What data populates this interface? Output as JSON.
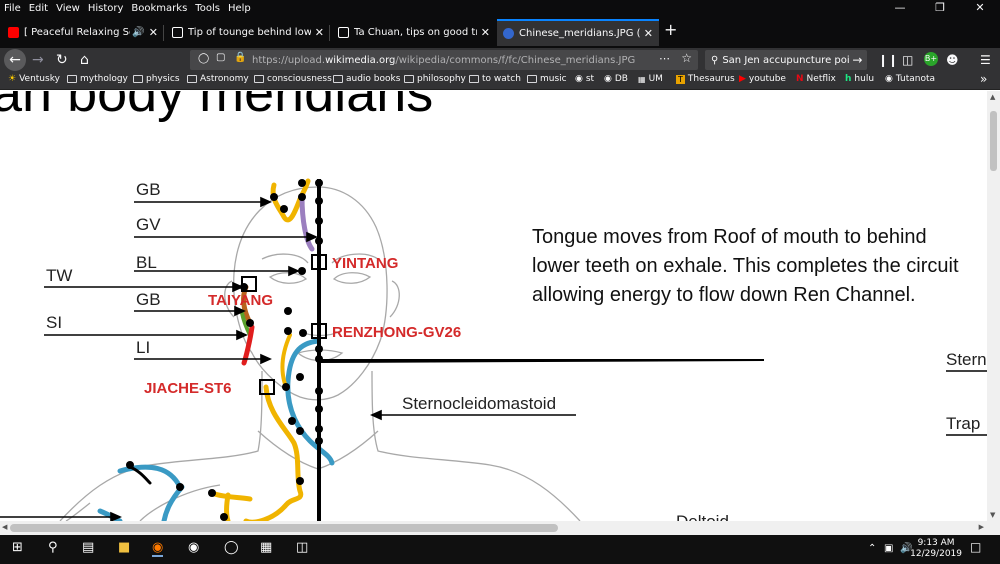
{
  "menu": [
    "File",
    "Edit",
    "View",
    "History",
    "Bookmarks",
    "Tools",
    "Help"
  ],
  "tabs": [
    {
      "title": "[ Peaceful Relaxing Soothing",
      "color": "#ff0000"
    },
    {
      "title": "Tip of tounge behind lower front",
      "color": "#ffffff"
    },
    {
      "title": "Ta Chuan, tips on good translati",
      "color": "#ffffff"
    },
    {
      "title": "Chinese_meridians.JPG (JPEG Im",
      "color": "#36c"
    }
  ],
  "url": {
    "prefix": "https://upload.",
    "domain": "wikimedia.org",
    "path": "/wikipedia/commons/f/fc/Chinese_meridians.JPG"
  },
  "search": "San Jen accupuncture point",
  "bookmarks": [
    "Ventusky",
    "mythology",
    "physics",
    "Astronomy",
    "consciousness",
    "audio books",
    "philosophy",
    "to watch",
    "music",
    "st",
    "DB",
    "UM",
    "Thesaurus",
    "youtube",
    "Netflix",
    "hulu",
    "Tutanota"
  ],
  "image": {
    "title": "an body meridians",
    "meridians": [
      "GB",
      "GV",
      "BL",
      "TW",
      "GB",
      "SI",
      "LI"
    ],
    "points": [
      "YINTANG",
      "TAIYANG",
      "RENZHONG-GV26",
      "JIACHE-ST6"
    ],
    "muscles": [
      "Sternocleidomastoid",
      "Stern",
      "Trap",
      "Deltoid"
    ],
    "note": "Tongue moves from Roof of mouth to behind lower teeth on exhale.  This completes the circuit allowing energy to flow down Ren Channel."
  },
  "clock": {
    "time": "9:13 AM",
    "date": "12/29/2019"
  }
}
